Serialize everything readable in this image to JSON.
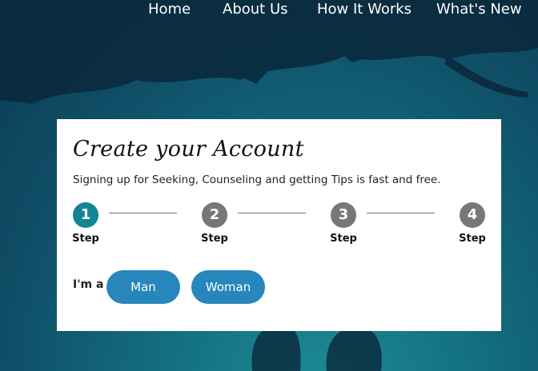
{
  "nav": {
    "items": [
      {
        "label": "Home"
      },
      {
        "label": "About Us"
      },
      {
        "label": "How It Works"
      },
      {
        "label": "What's New"
      }
    ]
  },
  "signup": {
    "title": "Create your Account",
    "subtitle": "Signing up for Seeking, Counseling and getting Tips is fast and free.",
    "steps": [
      {
        "number": "1",
        "label": "Step",
        "state": "active"
      },
      {
        "number": "2",
        "label": "Step",
        "state": "inactive"
      },
      {
        "number": "3",
        "label": "Step",
        "state": "inactive"
      },
      {
        "number": "4",
        "label": "Step",
        "state": "inactive"
      }
    ],
    "gender_prompt": "I'm a",
    "options": [
      {
        "label": "Man"
      },
      {
        "label": "Woman"
      }
    ]
  },
  "colors": {
    "step_active": "#138496",
    "step_inactive": "#777777",
    "button": "#2786bb"
  }
}
